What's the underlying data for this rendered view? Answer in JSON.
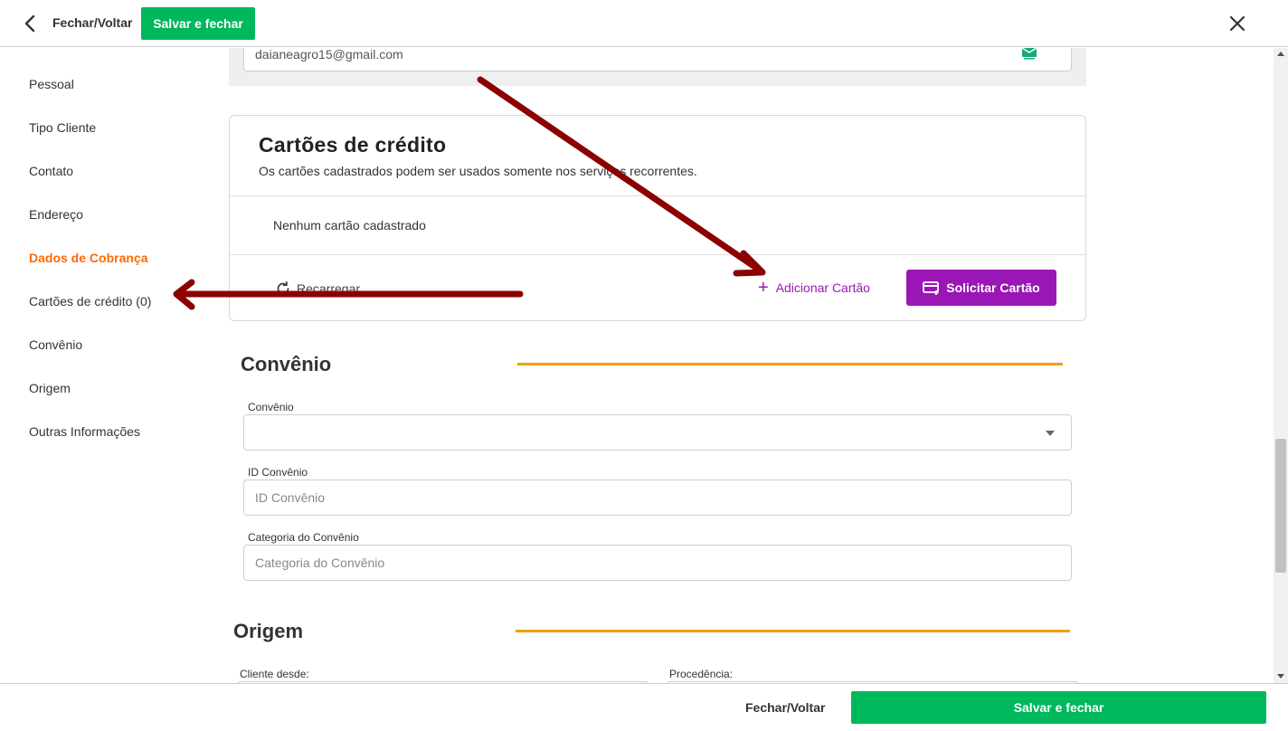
{
  "topbar": {
    "back_label": "Fechar/Voltar",
    "save_label": "Salvar e fechar"
  },
  "sidebar": {
    "items": [
      {
        "label": "Pessoal"
      },
      {
        "label": "Tipo Cliente"
      },
      {
        "label": "Contato"
      },
      {
        "label": "Endereço"
      },
      {
        "label": "Dados de Cobrança",
        "active": true
      },
      {
        "label": "Cartões de crédito (0)"
      },
      {
        "label": "Convênio"
      },
      {
        "label": "Origem"
      },
      {
        "label": "Outras Informações"
      }
    ]
  },
  "email": {
    "value": "daianeagro15@gmail.com"
  },
  "cards": {
    "title": "Cartões de crédito",
    "subtitle": "Os cartões cadastrados podem ser usados somente nos serviços recorrentes.",
    "empty": "Nenhum cartão cadastrado",
    "reload_label": "Recarregar",
    "add_label": "Adicionar Cartão",
    "request_label": "Solicitar Cartão"
  },
  "convenio": {
    "title": "Convênio",
    "select_label": "Convênio",
    "id_label": "ID Convênio",
    "id_placeholder": "ID Convênio",
    "cat_label": "Categoria do Convênio",
    "cat_placeholder": "Categoria do Convênio"
  },
  "origem": {
    "title": "Origem",
    "cliente_desde_label": "Cliente desde:",
    "procedencia_label": "Procedência:"
  },
  "bottombar": {
    "back_label": "Fechar/Voltar",
    "save_label": "Salvar e fechar"
  },
  "colors": {
    "accent_green": "#00b85c",
    "active_orange": "#ff6a00",
    "purple": "#9b16b6",
    "section_line": "#f59e0b",
    "annotation_arrow": "#8b0000"
  }
}
